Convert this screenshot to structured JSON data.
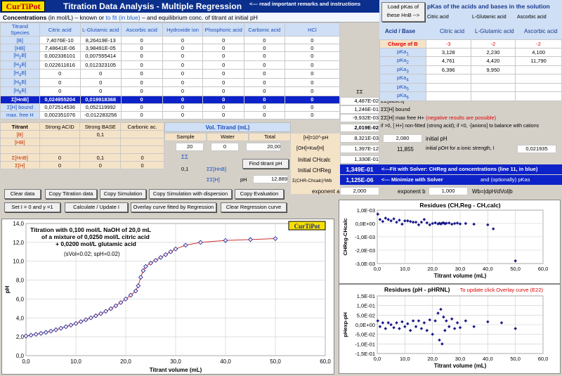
{
  "header": {
    "logo": "CurTiPot",
    "title": "Titration Data Analysis - Multiple Regression",
    "note": "<--- read important remarks and instructions"
  },
  "subtitle": {
    "p1": "Concentrations",
    "p2": " (in mol/L) – known or ",
    "p3": "to fit (in blue)",
    "p4": " – and equilibrium conc. of titrant at initial pH"
  },
  "conc_table": {
    "corner": [
      "Titrand",
      "Species"
    ],
    "cols": [
      "Citric acid",
      "L-Glutamic acid",
      "Ascorbic acid",
      "Hydroxide ion",
      "Phosphoric acid",
      "Carbonic acid",
      "HCl"
    ],
    "rows": [
      {
        "label": "[B]",
        "vals": [
          "7,4076E-10",
          "8,26419E-13",
          "0",
          "0",
          "0",
          "0",
          "0"
        ]
      },
      {
        "label": "[HB]",
        "vals": [
          "7,48641E-06",
          "3,98491E-05",
          "0",
          "0",
          "0",
          "0",
          "0"
        ]
      },
      {
        "label": "[H2B]",
        "vals": [
          "0,002336101",
          "0,007555414",
          "0",
          "0",
          "0",
          "0",
          "0"
        ]
      },
      {
        "label": "[H3B]",
        "vals": [
          "0,022611616",
          "0,012323105",
          "0",
          "0",
          "0",
          "0",
          "0"
        ]
      },
      {
        "label": "[H4B]",
        "vals": [
          "0",
          "0",
          "0",
          "0",
          "0",
          "0",
          "0"
        ]
      },
      {
        "label": "[H5B]",
        "vals": [
          "0",
          "0",
          "0",
          "0",
          "0",
          "0",
          "0"
        ]
      },
      {
        "label": "[H6B]",
        "vals": [
          "0",
          "0",
          "0",
          "0",
          "0",
          "0",
          "0"
        ]
      }
    ],
    "sum_label": "Σ[HnB]",
    "sum_vals": [
      "0,024955204",
      "0,019918368",
      "0",
      "0",
      "0",
      "0",
      "0"
    ],
    "bound_label": "Σ[H] bound",
    "bound_vals": [
      "0,072514536",
      "0,052119992",
      "0",
      "0",
      "0",
      "0",
      "0"
    ],
    "free_label": "max. free H",
    "free_vals": [
      "0,002351076",
      "-0,012283256",
      "0",
      "0",
      "0",
      "0",
      "0"
    ]
  },
  "sums": {
    "ss": "ΣΣ",
    "v1": "4,487E-02",
    "v2": "1,246E-01",
    "v3": "-9,932E-03",
    "v4": "2,019E-02"
  },
  "sum_labels": {
    "l1": "ΣΣ[bases]",
    "l2": "ΣΣ[H] bound",
    "l3a": "ΣΣ[H] max free H+ ",
    "l3b": "(negative results are possible)",
    "l4": "if >0, [ H+] non-fitted (strong acid); if <0, -[anions] to balance with cations"
  },
  "titrant": {
    "label": "Titrant",
    "cols": [
      "Strong ACID",
      "Strong BASE",
      "Carbonic ac."
    ],
    "rows": [
      {
        "label": "[B]",
        "vals": [
          "",
          "0,1",
          ""
        ]
      },
      {
        "label": "[HB]",
        "vals": [
          "",
          "",
          ""
        ]
      },
      {
        "label": "",
        "vals": [
          "",
          "",
          ""
        ]
      },
      {
        "label": "Σ[HnB]",
        "vals": [
          "0",
          "0,1",
          "0"
        ]
      },
      {
        "label": "Σ[H]",
        "vals": [
          "0",
          "0",
          "0"
        ]
      }
    ],
    "vol_title": "Vol. Titrand (mL)",
    "vol_cols": [
      "Sample",
      "Water",
      "Total"
    ],
    "vol_vals": [
      "20",
      "0",
      "20,00"
    ],
    "ss": "ΣΣ",
    "v01": "0,1",
    "ss_hnb": "ΣΣ[HnB]",
    "ss_h": "ΣΣ[H]",
    "ph_label": "pH",
    "ph_val": "12,889",
    "find_btn": "Find titrant pH"
  },
  "calc": {
    "h_label": "[H]=10^-pH",
    "h_val": "8,321E-03",
    "ph_val": "2,080",
    "ph_label": "initial pH",
    "oh_label": "[OH]=Kw/[H]",
    "oh_val": "1,397E-12",
    "poh_val": "11,855",
    "poh_label": "initial pOH for a ionic strength, I",
    "i_val": "0,021935",
    "chcalc_label": "Initial CHcalc",
    "chcalc_val": "1,330E-01",
    "chreg_label": "Initial CHReg",
    "chreg_val": "1,349E-01",
    "chreg_note": "<---Fit with Solver: CHReg and concentrations (line 11, in blue)",
    "sig_label": "Σ(CHR-Chcalc)²Wb",
    "sig_val": "1,125E-06",
    "sig_note": "<--- Minimize with Solver",
    "opt_note": "and (optionally) pKas",
    "expa_label": "exponent a",
    "expa_val": "2,000",
    "expb_label": "exponent b",
    "expb_val": "1,000",
    "w_label": "Wb=|dpH/dVol|b"
  },
  "pka": {
    "btn": "Load pKas of these HnB -->",
    "title": "pKas of the acids and bases in the solution",
    "species": [
      "Citric acid",
      "L-Glutamic acid",
      "Ascorbic acid"
    ],
    "ab_label": "Acid / Base",
    "charge_label": "Charge of B",
    "charges": [
      "-3",
      "-2",
      "-2"
    ],
    "rows": [
      {
        "label": "pKa1",
        "vals": [
          "3,128",
          "2,230",
          "4,100"
        ]
      },
      {
        "label": "pKa2",
        "vals": [
          "4,761",
          "4,420",
          "11,790"
        ]
      },
      {
        "label": "pKa3",
        "vals": [
          "6,396",
          "9,950",
          ""
        ]
      },
      {
        "label": "pKa4",
        "vals": [
          "",
          "",
          ""
        ]
      },
      {
        "label": "pKa5",
        "vals": [
          "",
          "",
          ""
        ]
      },
      {
        "label": "pKa6",
        "vals": [
          "",
          "",
          ""
        ]
      }
    ]
  },
  "buttons": {
    "clear": "Clear data",
    "copy_titr": "Copy Titration data",
    "copy_sim": "Copy Simulation",
    "copy_sim_disp": "Copy Simulation with dispersion",
    "copy_eval": "Copy Evaluation",
    "set_i": "Set I = 0 and y =1",
    "calc": "Calculate / Update I",
    "overlay": "Overlay curve fitted by Regression",
    "clear_reg": "Clear Regression curve"
  },
  "main_chart": {
    "logo": "CurTiPot",
    "t1": "Titration with 0,100 mol/L NaOH  of 20,0 mL",
    "t2": "of a mixture of 0,0250 mol/L citric acid",
    "t3": "+ 0,0200 mol/L glutamic acid",
    "t4": "(sVol=0.02; spH=0.02)",
    "ylabel": "pH",
    "xlabel": "Titrant volume (mL)",
    "xticks": [
      "0,0",
      "10,0",
      "20,0",
      "30,0",
      "40,0",
      "50,0",
      "60,0"
    ],
    "yticks": [
      "0,0",
      "2,0",
      "4,0",
      "6,0",
      "8,0",
      "10,0",
      "12,0",
      "14,0"
    ]
  },
  "res1_chart": {
    "title": "Residues (CH,Reg - CH,calc)",
    "ylabel": "CHReg-CHcalc",
    "xlabel": "Titrant volume (mL)",
    "xticks": [
      "0,0",
      "10,0",
      "20,0",
      "30,0",
      "40,0",
      "50,0",
      "60,0"
    ],
    "yticks": [
      "1,0E-03",
      "0,0E+00",
      "-1,0E-03",
      "-2,0E-03",
      "-3,0E-03"
    ]
  },
  "res2_chart": {
    "title": "Residues (pH - pHRNL)",
    "note": "To update click Overlay curve (E22)",
    "ylabel": "pHexp-pH",
    "xlabel": "Titrant volume (mL)",
    "xticks": [
      "0,0",
      "10,0",
      "20,0",
      "30,0",
      "40,0",
      "50,0",
      "60,0"
    ],
    "yticks": [
      "1,5E-01",
      "1,0E-01",
      "5,0E-02",
      "0,0E+00",
      "-5,0E-02",
      "-1,0E-01",
      "-1,5E-01"
    ]
  },
  "chart_data": [
    {
      "type": "scatter",
      "title": "",
      "xlabel": "Titrant volume (mL)",
      "ylabel": "pH",
      "xlim": [
        0,
        60
      ],
      "ylim": [
        0,
        14
      ],
      "points": [
        [
          0,
          2.08
        ],
        [
          1,
          2.17
        ],
        [
          2,
          2.26
        ],
        [
          3,
          2.36
        ],
        [
          4,
          2.47
        ],
        [
          5,
          2.6
        ],
        [
          6,
          2.74
        ],
        [
          7,
          2.9
        ],
        [
          8,
          3.06
        ],
        [
          9,
          3.23
        ],
        [
          10,
          3.41
        ],
        [
          11,
          3.6
        ],
        [
          12,
          3.8
        ],
        [
          13,
          4.0
        ],
        [
          14,
          4.22
        ],
        [
          15,
          4.45
        ],
        [
          16,
          4.7
        ],
        [
          17,
          4.97
        ],
        [
          18,
          5.28
        ],
        [
          19,
          5.62
        ],
        [
          20,
          6.0
        ],
        [
          21,
          6.4
        ],
        [
          22,
          6.85
        ],
        [
          22.5,
          7.4
        ],
        [
          23,
          8.3
        ],
        [
          23.5,
          9.0
        ],
        [
          24,
          9.45
        ],
        [
          25,
          9.8
        ],
        [
          26,
          10.1
        ],
        [
          27,
          10.4
        ],
        [
          28,
          10.7
        ],
        [
          29,
          11.0
        ],
        [
          30,
          11.3
        ],
        [
          32,
          11.7
        ],
        [
          35,
          12.0
        ],
        [
          40,
          12.2
        ],
        [
          45,
          12.3
        ],
        [
          50,
          12.4
        ]
      ]
    },
    {
      "type": "scatter",
      "title": "Residues (CH,Reg - CH,calc)",
      "xlim": [
        0,
        60
      ],
      "ylim": [
        -0.003,
        0.001
      ],
      "points": [
        [
          0.2,
          0.0007
        ],
        [
          1,
          0.0003
        ],
        [
          2,
          0.00015
        ],
        [
          3,
          0.0004
        ],
        [
          4,
          0.0003
        ],
        [
          5,
          0.0002
        ],
        [
          6,
          0.00035
        ],
        [
          7,
          0.0001
        ],
        [
          8,
          0.00025
        ],
        [
          9,
          -5e-05
        ],
        [
          10,
          0.0002
        ],
        [
          11,
          0.0002
        ],
        [
          12,
          0.00015
        ],
        [
          13,
          0.0001
        ],
        [
          14,
          0.0001
        ],
        [
          15,
          -0.0001
        ],
        [
          16,
          0.0001
        ],
        [
          17,
          0.0003
        ],
        [
          18,
          5e-05
        ],
        [
          19,
          -0.0001
        ],
        [
          20,
          0
        ],
        [
          21,
          5e-05
        ],
        [
          22,
          -3e-05
        ],
        [
          22.5,
          2e-05
        ],
        [
          23,
          -4e-05
        ],
        [
          23.5,
          3e-05
        ],
        [
          24,
          5e-05
        ],
        [
          24.5,
          -2e-05
        ],
        [
          25,
          2e-05
        ],
        [
          26,
          4e-05
        ],
        [
          27,
          -5e-05
        ],
        [
          28,
          0
        ],
        [
          29,
          3e-05
        ],
        [
          30,
          -3e-05
        ],
        [
          32,
          0
        ],
        [
          35,
          -5e-05
        ],
        [
          40,
          -0.0001
        ],
        [
          42,
          -0.0004
        ],
        [
          50,
          -0.0028
        ]
      ]
    },
    {
      "type": "scatter",
      "title": "Residues (pH - pHRNL)",
      "xlim": [
        0,
        60
      ],
      "ylim": [
        -0.15,
        0.15
      ],
      "points": [
        [
          0.2,
          0.02
        ],
        [
          1,
          -0.01
        ],
        [
          2,
          0.01
        ],
        [
          3,
          -0.02
        ],
        [
          4,
          0.01
        ],
        [
          5,
          0
        ],
        [
          6,
          -0.015
        ],
        [
          7,
          0.01
        ],
        [
          8,
          -0.02
        ],
        [
          9,
          0.015
        ],
        [
          10,
          -0.01
        ],
        [
          11,
          0.005
        ],
        [
          12,
          -0.03
        ],
        [
          13,
          0.02
        ],
        [
          14,
          -0.01
        ],
        [
          15,
          0.02
        ],
        [
          16,
          -0.02
        ],
        [
          17,
          0.01
        ],
        [
          18,
          -0.03
        ],
        [
          19,
          0.025
        ],
        [
          20,
          -0.05
        ],
        [
          21,
          0.02
        ],
        [
          22,
          0.06
        ],
        [
          22.5,
          -0.08
        ],
        [
          23,
          0.08
        ],
        [
          23.5,
          -0.1
        ],
        [
          24,
          0.04
        ],
        [
          24.5,
          -0.03
        ],
        [
          25,
          0.02
        ],
        [
          26,
          -0.01
        ],
        [
          27,
          0.03
        ],
        [
          28,
          -0.02
        ],
        [
          29,
          0.01
        ],
        [
          30,
          -0.015
        ],
        [
          32,
          0.02
        ],
        [
          35,
          -0.01
        ],
        [
          40,
          0.015
        ],
        [
          45,
          0.01
        ],
        [
          50,
          -0.02
        ]
      ]
    }
  ]
}
